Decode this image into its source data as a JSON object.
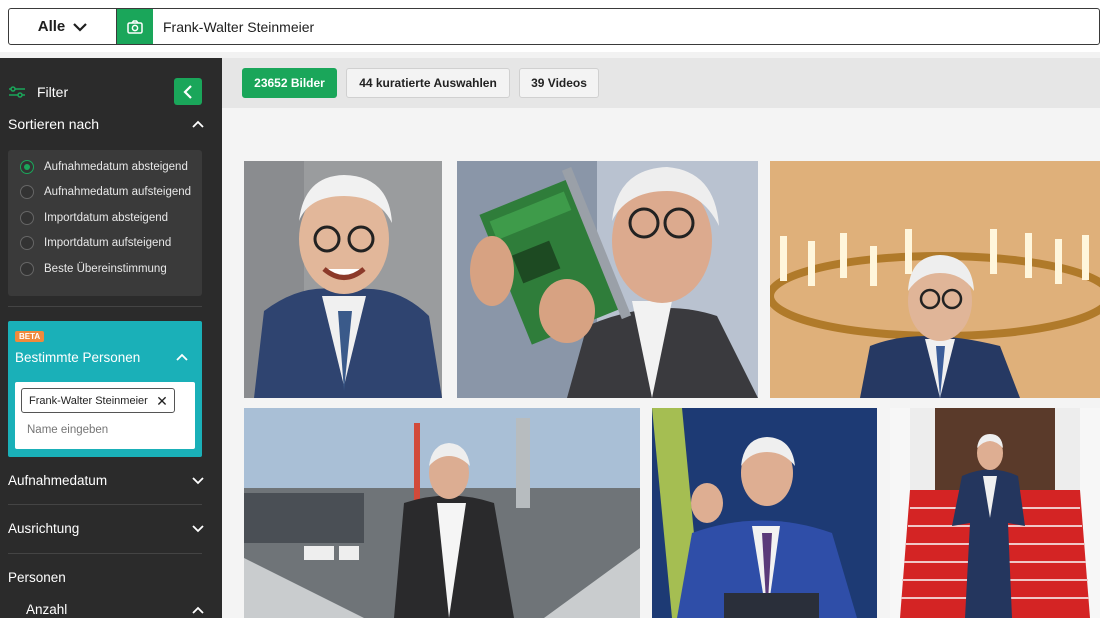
{
  "search": {
    "scope_label": "Alle",
    "query": "Frank-Walter Steinmeier"
  },
  "sidebar": {
    "filter_label": "Filter",
    "sort_heading": "Sortieren nach",
    "sort_options": [
      {
        "label": "Aufnahmedatum absteigend",
        "selected": true
      },
      {
        "label": "Aufnahmedatum aufsteigend",
        "selected": false
      },
      {
        "label": "Importdatum absteigend",
        "selected": false
      },
      {
        "label": "Importdatum aufsteigend",
        "selected": false
      },
      {
        "label": "Beste Übereinstimmung",
        "selected": false
      }
    ],
    "persons": {
      "badge": "BETA",
      "heading": "Bestimmte Personen",
      "chip_label": "Frank-Walter Steinmeier",
      "input_placeholder": "Name eingeben"
    },
    "groups": {
      "date": "Aufnahmedatum",
      "orientation": "Ausrichtung",
      "people": "Personen",
      "count": "Anzahl"
    }
  },
  "tabs": {
    "images": "23652 Bilder",
    "curated": "44 kuratierte Auswahlen",
    "videos": "39 Videos"
  },
  "colors": {
    "accent": "#1aa65a",
    "sidebar_bg": "#2b2b2b",
    "persons_bg": "#1ab0b8",
    "beta_badge": "#f08a3c"
  }
}
